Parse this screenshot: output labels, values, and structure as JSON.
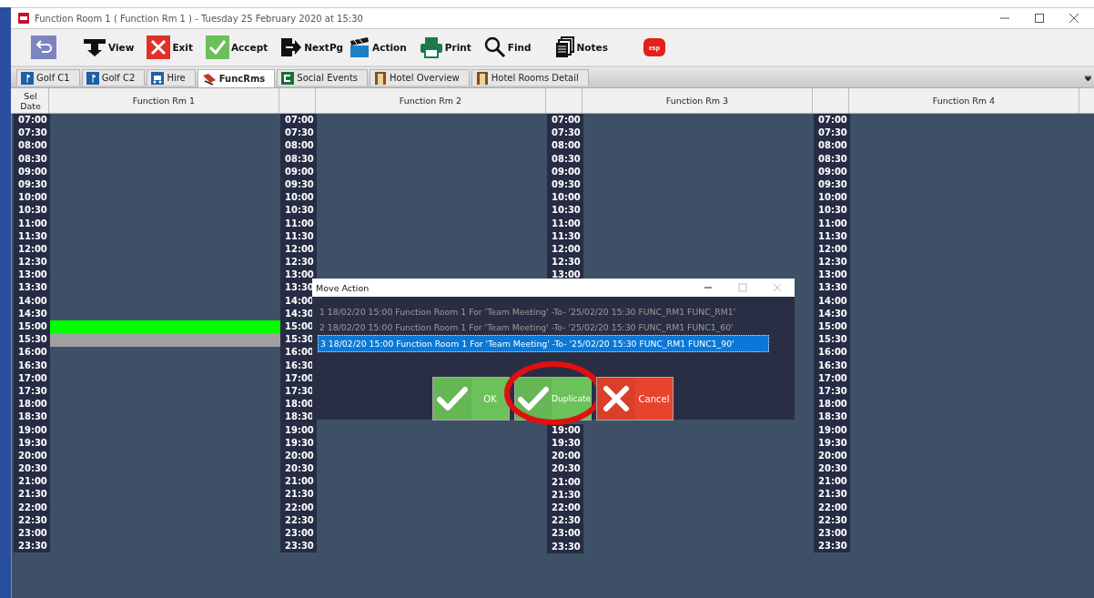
{
  "window": {
    "title": "Function Room 1 ( Function Rm 1 )  - Tuesday 25 February 2020 at 15:30"
  },
  "toolbar": [
    {
      "kind": "back"
    },
    {
      "kind": "view",
      "label": "View"
    },
    {
      "kind": "exit",
      "label": "Exit"
    },
    {
      "kind": "accept",
      "label": "Accept"
    },
    {
      "kind": "next",
      "label": "NextPg"
    },
    {
      "kind": "action",
      "label": "Action"
    },
    {
      "kind": "print",
      "label": "Print"
    },
    {
      "kind": "find",
      "label": "Find"
    },
    {
      "kind": "notes",
      "label": "Notes"
    },
    {
      "kind": "logo",
      "label": "esp"
    }
  ],
  "tabs": [
    {
      "label": "Golf C1",
      "kind": "golf",
      "selected": false
    },
    {
      "label": "Golf C2",
      "kind": "golf",
      "selected": false
    },
    {
      "label": "Hire",
      "kind": "hire",
      "selected": false
    },
    {
      "label": "FuncRms",
      "kind": "func",
      "selected": true
    },
    {
      "label": "Social Events",
      "kind": "social",
      "selected": false
    },
    {
      "label": "Hotel Overview",
      "kind": "hotel",
      "selected": false
    },
    {
      "label": "Hotel Rooms Detail",
      "kind": "hotel",
      "selected": false
    }
  ],
  "grid": {
    "sel_date_header": "Sel Date",
    "columns": [
      {
        "room": "Function Rm 1",
        "time_blocks": [
          [
            "07:00",
            "07:30",
            "08:00",
            "08:30",
            "09:00",
            "09:30",
            "10:00",
            "10:30",
            "11:00",
            "11:30",
            "12:00",
            "12:30",
            "13:00",
            "13:30",
            "14:00",
            "14:30",
            {
              "time": "15:00",
              "color": "#00ff00"
            },
            {
              "time": "15:30",
              "color": "#a0a0a0"
            },
            "16:00",
            "16:30",
            "17:00",
            "17:30",
            "18:00",
            "18:30",
            "19:00",
            "19:30",
            "20:00",
            "20:30",
            "21:00",
            "21:30",
            "22:00",
            "22:30",
            "23:00",
            "23:30"
          ]
        ]
      },
      {
        "room": "Function Rm 2",
        "time_blocks": [
          [
            "07:00",
            "07:30",
            "08:00",
            "08:30",
            "09:00",
            "09:30",
            "10:00",
            "10:30",
            "11:00",
            "11:30",
            "12:00",
            "12:30",
            "13:00",
            "13:30",
            "14:00",
            "14:30",
            "15:00",
            "15:30",
            "16:00",
            "16:30",
            "17:00",
            "17:30",
            "18:00",
            "18:30",
            "19:00",
            "19:30",
            "20:00",
            "20:30",
            "21:00",
            "21:30",
            "22:00",
            "22:30",
            "23:00",
            "23:30"
          ]
        ]
      },
      {
        "room": "Function Rm 3",
        "time_blocks": [
          [
            "07:00",
            "07:30",
            "08:00",
            "08:30",
            "09:00",
            "09:30",
            "10:00",
            "10:30",
            "11:00",
            "11:30",
            "12:00",
            "12:30",
            "13:00"
          ],
          [
            "19:00",
            "19:30",
            "20:00",
            "20:30",
            "21:00",
            "21:30",
            "22:00",
            "22:30",
            "23:00",
            "23:30"
          ]
        ]
      },
      {
        "room": "Function Rm 4",
        "time_blocks": [
          [
            "07:00",
            "07:30",
            "08:00",
            "08:30",
            "09:00",
            "09:30",
            "10:00",
            "10:30",
            "11:00",
            "11:30",
            "12:00",
            "12:30",
            "13:00",
            "13:30",
            "14:00",
            "14:30",
            "15:00",
            "15:30",
            "16:00",
            "16:30",
            "17:00",
            "17:30",
            "18:00",
            "18:30",
            "19:00",
            "19:30",
            "20:00",
            "20:30",
            "21:00",
            "21:30",
            "22:00",
            "22:30",
            "23:00",
            "23:30"
          ]
        ]
      }
    ]
  },
  "dialog": {
    "title": "Move Action",
    "items": [
      {
        "text": "1 18/02/20 15:00 Function Room 1 For 'Team Meeting' -To- '25/02/20 15:30 FUNC_RM1   FUNC_RM1'",
        "selected": false
      },
      {
        "text": "2 18/02/20 15:00 Function Room 1 For 'Team Meeting' -To- '25/02/20 15:30 FUNC_RM1   FUNC1_60'",
        "selected": false
      },
      {
        "text": "3 18/02/20 15:00 Function Room 1 For 'Team Meeting' -To- '25/02/20 15:30 FUNC_RM1   FUNC1_90'",
        "selected": true
      }
    ],
    "buttons": [
      {
        "kind": "ok",
        "label": "OK",
        "circled": false
      },
      {
        "kind": "duplicate",
        "label": "Duplicate",
        "circled": true
      },
      {
        "kind": "cancel",
        "label": "Cancel",
        "circled": false
      }
    ]
  }
}
